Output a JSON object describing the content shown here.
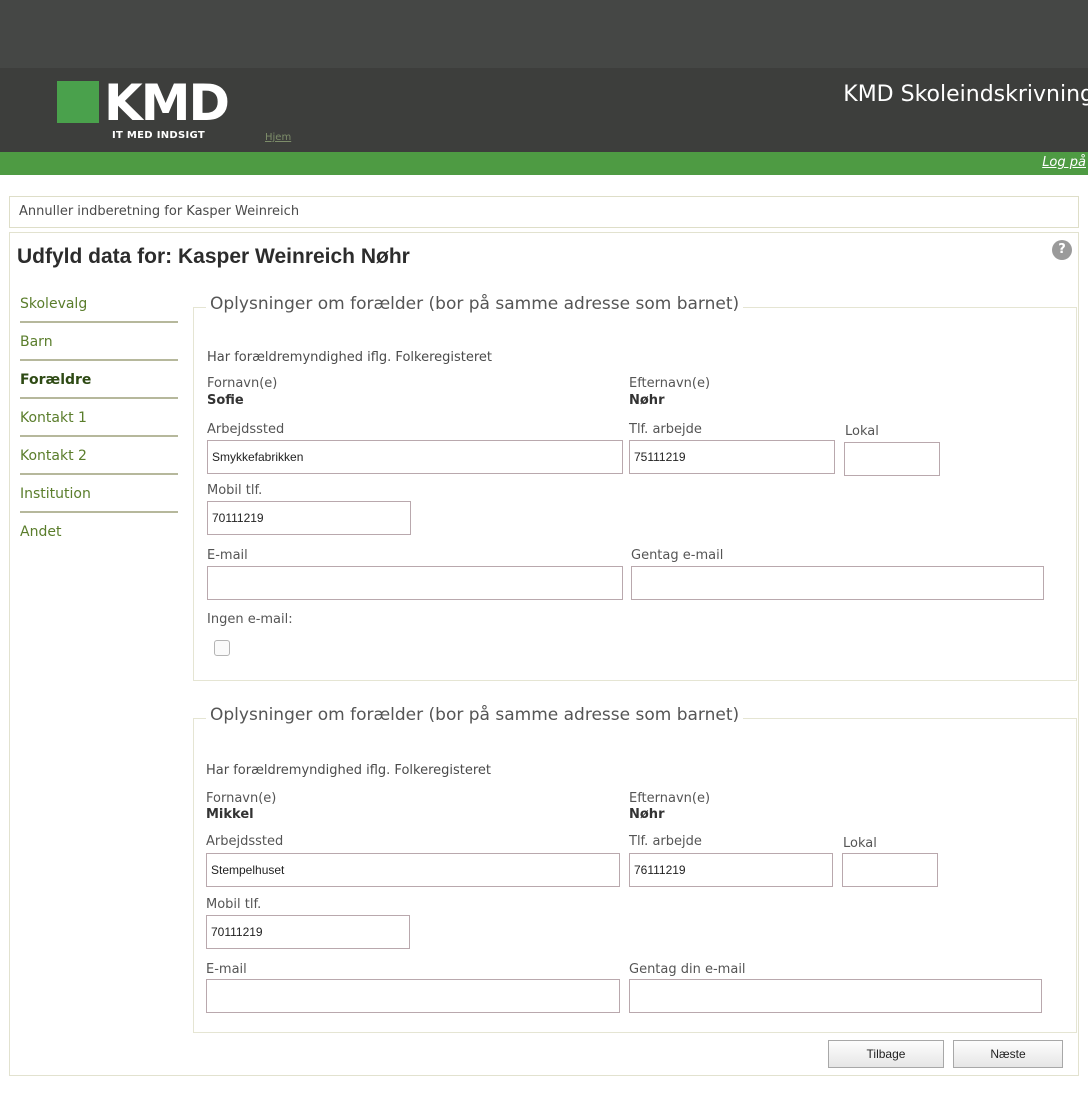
{
  "header": {
    "logo_text": "KMD",
    "logo_tagline": "IT MED INDSIGT",
    "home_link": "Hjem",
    "app_title": "KMD Skoleindskrivning",
    "login_link": "Log på"
  },
  "cancel_link": "Annuller indberetning for Kasper Weinreich",
  "page_title": "Udfyld data for: Kasper Weinreich Nøhr",
  "help_icon": "?",
  "nav": [
    "Skolevalg",
    "Barn",
    "Forældre",
    "Kontakt 1",
    "Kontakt 2",
    "Institution",
    "Andet"
  ],
  "nav_active": "Forældre",
  "parent1": {
    "legend": "Oplysninger om forælder (bor på samme adresse som barnet)",
    "custody_text": "Har forældremyndighed iflg. Folkeregisteret",
    "firstname_label": "Fornavn(e)",
    "firstname": "Sofie",
    "lastname_label": "Efternavn(e)",
    "lastname": "Nøhr",
    "workplace_label": "Arbejdssted",
    "workplace": "Smykkefabrikken",
    "work_phone_label": "Tlf. arbejde",
    "work_phone": "75111219",
    "local_label": "Lokal",
    "local": "",
    "mobile_label": "Mobil tlf.",
    "mobile": "70111219",
    "email_label": "E-mail",
    "email": "",
    "email_repeat_label": "Gentag e-mail",
    "email_repeat": "",
    "no_email_label": "Ingen e-mail:"
  },
  "parent2": {
    "legend": "Oplysninger om forælder (bor på samme adresse som barnet)",
    "custody_text": "Har forældremyndighed iflg. Folkeregisteret",
    "firstname_label": "Fornavn(e)",
    "firstname": "Mikkel",
    "lastname_label": "Efternavn(e)",
    "lastname": "Nøhr",
    "workplace_label": "Arbejdssted",
    "workplace": "Stempelhuset",
    "work_phone_label": "Tlf. arbejde",
    "work_phone": "76111219",
    "local_label": "Lokal",
    "local": "",
    "mobile_label": "Mobil tlf.",
    "mobile": "70111219",
    "email_label": "E-mail",
    "email": "",
    "email_repeat_label": "Gentag din e-mail",
    "email_repeat": ""
  },
  "buttons": {
    "back": "Tilbage",
    "next": "Næste"
  },
  "colors": {
    "header_bg": "#3d3e3c",
    "green_bar": "#4e9b43",
    "logo_green": "#4aa14c",
    "nav_link": "#5a7d2b"
  }
}
